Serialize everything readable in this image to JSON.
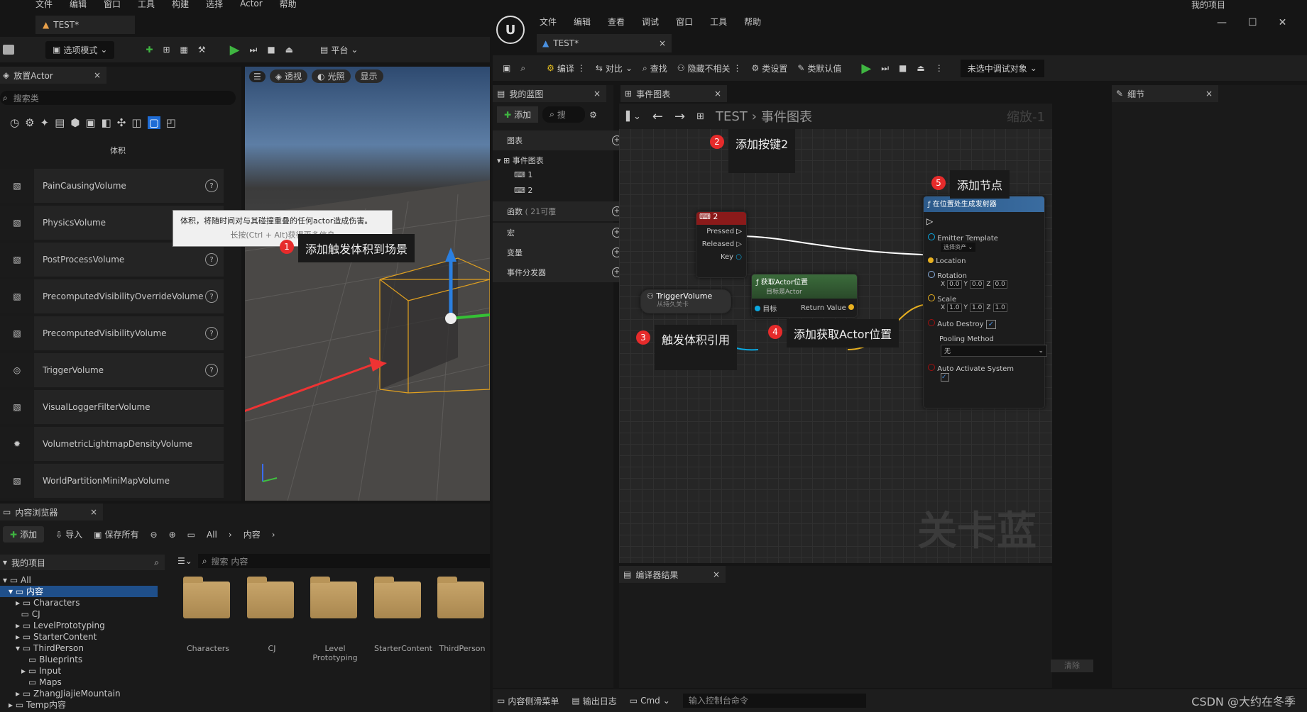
{
  "left_menu": [
    "文件",
    "编辑",
    "窗口",
    "工具",
    "构建",
    "选择",
    "Actor",
    "帮助"
  ],
  "left_tab": "TEST*",
  "left_toolbar": {
    "mode": "选项模式",
    "platform": "平台"
  },
  "place_actor": {
    "title": "放置Actor",
    "search_placeholder": "搜索类",
    "category": "体积",
    "items": [
      "PainCausingVolume",
      "PhysicsVolume",
      "PostProcessVolume",
      "PrecomputedVisibilityOverrideVolume",
      "PrecomputedVisibilityVolume",
      "TriggerVolume",
      "VisualLoggerFilterVolume",
      "VolumetricLightmapDensityVolume",
      "WorldPartitionMiniMapVolume"
    ],
    "tooltip_main": "体积，将随时间对与其碰撞重叠的任何actor造成伤害。",
    "tooltip_sub": "长按(Ctrl + Alt)获得更多信息"
  },
  "viewport": {
    "perspective": "透视",
    "lit": "光照",
    "show": "显示"
  },
  "content_browser": {
    "title": "内容浏览器",
    "add": "添加",
    "import": "导入",
    "save_all": "保存所有",
    "crumbs": [
      "All",
      "内容"
    ],
    "project": "我的项目",
    "search_placeholder": "搜索 内容",
    "tree": [
      "All",
      "内容",
      "Characters",
      "CJ",
      "LevelPrototyping",
      "StarterContent",
      "ThirdPerson",
      "Blueprints",
      "Input",
      "Maps",
      "ZhangJiajieMountain",
      "Temp内容"
    ],
    "folders": [
      "Characters",
      "CJ",
      "Level Prototyping",
      "StarterContent",
      "ThirdPerson"
    ]
  },
  "bp_menu": [
    "文件",
    "编辑",
    "查看",
    "调试",
    "窗口",
    "工具",
    "帮助"
  ],
  "project_name": "我的项目",
  "bp_tab": "TEST*",
  "bp_toolbar": {
    "compile": "编译",
    "diff": "对比",
    "find": "查找",
    "hide": "隐藏不相关",
    "class_settings": "类设置",
    "class_defaults": "类默认值",
    "debug": "未选中调试对象"
  },
  "my_bp": {
    "title": "我的蓝图",
    "add": "添加",
    "search": "搜",
    "graphs": "图表",
    "event_graph": "事件图表",
    "g1": "1",
    "g2": "2",
    "functions": "函数",
    "functions_count": "( 21可覆",
    "macros": "宏",
    "variables": "变量",
    "dispatchers": "事件分发器"
  },
  "graph": {
    "tab": "事件图表",
    "path_root": "TEST",
    "path_leaf": "事件图表",
    "zoom": "缩放-1",
    "watermark": "关卡蓝图"
  },
  "details_title": "细节",
  "compiler_title": "编译器结果",
  "clear": "清除",
  "nodes": {
    "key": {
      "title": "2",
      "pressed": "Pressed",
      "released": "Released",
      "key": "Key"
    },
    "get_loc": {
      "title": "获取Actor位置",
      "sub": "目标是Actor",
      "target": "目标",
      "ret": "Return Value"
    },
    "trigger": {
      "title": "TriggerVolume",
      "sub": "从持久关卡"
    },
    "spawn": {
      "title": "在位置处生成发射器",
      "emitter": "Emitter Template",
      "asset": "选择资产",
      "location": "Location",
      "rotation": "Rotation",
      "rot": [
        "0.0",
        "0.0",
        "0.0"
      ],
      "scale": "Scale",
      "sc": [
        "1.0",
        "1.0",
        "1.0"
      ],
      "auto_destroy": "Auto Destroy",
      "pooling": "Pooling Method",
      "pool_val": "无",
      "auto_activate": "Auto Activate System"
    }
  },
  "annotations": [
    "添加触发体积到场景",
    "添加按键2",
    "触发体积引用",
    "添加获取Actor位置",
    "添加节点"
  ],
  "bottom": {
    "drawer": "内容侧滑菜单",
    "output": "输出日志",
    "cmd": "Cmd",
    "console_placeholder": "输入控制台命令",
    "credit": "CSDN @大约在冬季"
  }
}
